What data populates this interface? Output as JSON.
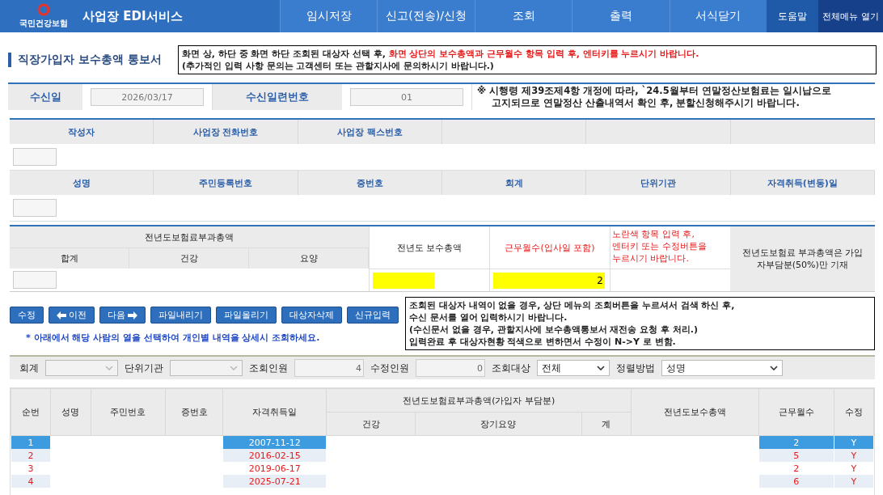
{
  "header": {
    "logo_text": "국민건강보험",
    "title": "사업장 EDI서비스",
    "menu": [
      {
        "label": "임시저장"
      },
      {
        "label": "신고(전송)/신청"
      },
      {
        "label": "조회"
      },
      {
        "label": "출력"
      },
      {
        "label": "서식닫기"
      }
    ],
    "help": "도움말",
    "all_menu": "전체메뉴 열기"
  },
  "page_title": "직장가입자 보수총액 통보서",
  "notice_top": [
    [
      {
        "text": "화면 상, 하단 중 화면 하단 조회된 대상자 선택 후, ",
        "emphasis": false
      },
      {
        "text": "화면 상단의 보수총액과 근무월수 항목 입력 후, 엔터키를 누르시기 바랍니다.",
        "emphasis": true
      }
    ],
    [
      {
        "text": "(추가적인 입력 사항 문의는 고객센터 또는 관할지사에 문의하시기 바랍니다.)",
        "emphasis": false
      }
    ]
  ],
  "receipt": {
    "date_label": "수신일",
    "date": "2026/03/17",
    "serial_label": "수신일련번호",
    "serial": "01",
    "notice": [
      "※ 시행령 제39조제4항 개정에 따라, `24.5월부터 연말정산보험료는 일시납으로",
      "고지되므로 연말정산 산출내역서 확인 후, 분할신청해주시기 바랍니다."
    ]
  },
  "company_columns": [
    "작성자",
    "사업장 전화번호",
    "사업장 팩스번호"
  ],
  "member_columns": [
    "성명",
    "주민등록번호",
    "증번호",
    "회계",
    "단위기관",
    "자격취득(변동)일"
  ],
  "premium": {
    "group": "전년도보험료부과총액",
    "subs": [
      "합계",
      "건강",
      "요양"
    ],
    "pay_total": "전년도 보수총액",
    "months": "근무월수(입사일 포함)",
    "hint": [
      "노란색 항목 입력 후,",
      "엔터키 또는 수정버튼을",
      "누르시기 바랍니다."
    ],
    "note": "전년도보험료 부과총액은 가입자부담분(50%)만 기재",
    "months_value": "2",
    "highlighted": true
  },
  "buttons": [
    {
      "label": "수정",
      "kind": "plain"
    },
    {
      "label": "이전",
      "kind": "prev"
    },
    {
      "label": "다음",
      "kind": "next"
    },
    {
      "label": "파일내리기",
      "kind": "plain"
    },
    {
      "label": "파일올리기",
      "kind": "plain"
    },
    {
      "label": "대상자삭제",
      "kind": "plain"
    },
    {
      "label": "신규입력",
      "kind": "plain"
    }
  ],
  "row_hint": "* 아래에서 해당 사람의 열을 선택하여 개인별 내역을 상세시 조회하세요.",
  "notice_box": [
    "조회된 대상자 내역이 없을 경우, 상단 메뉴의 조회버튼을 누르셔서 검색 하신 후,",
    "수신 문서를 열어 입력하시기 바랍니다.",
    "(수신문서 없을 경우, 관할지사에 보수총액통보서 재전송 요청 후 처리.)",
    "입력완료 후 대상자현황 적색으로 변하면서 수정이 N->Y 로 변함."
  ],
  "filters": [
    {
      "label": "회계",
      "kind": "select",
      "disabled": true
    },
    {
      "label": "단위기관",
      "kind": "select",
      "disabled": true
    },
    {
      "label": "조회인원",
      "kind": "number",
      "value": "4",
      "disabled": true
    },
    {
      "label": "수정인원",
      "kind": "number",
      "value": "0",
      "disabled": true
    },
    {
      "label": "조회대상",
      "kind": "select",
      "value": "전체",
      "disabled": false
    },
    {
      "label": "정렬방법",
      "kind": "select",
      "value": "성명",
      "disabled": false
    }
  ],
  "table": {
    "columns": [
      "순번",
      "성명",
      "주민번호",
      "증번호",
      "자격취득일"
    ],
    "group": "전년도보험료부과총액(가입자 부담분)",
    "group_subs": [
      "건강",
      "장기요양",
      "계"
    ],
    "tail_columns": [
      "전년도보수총액",
      "근무월수",
      "수정"
    ],
    "rows": [
      {
        "no": "1",
        "date": "2007-11-12",
        "months": "2",
        "edited": "Y",
        "selected": true,
        "modified": true
      },
      {
        "no": "2",
        "date": "2016-02-15",
        "months": "5",
        "edited": "Y",
        "selected": false,
        "modified": true
      },
      {
        "no": "3",
        "date": "2019-06-17",
        "months": "2",
        "edited": "Y",
        "selected": false,
        "modified": true
      },
      {
        "no": "4",
        "date": "2025-07-21",
        "months": "6",
        "edited": "Y",
        "selected": false,
        "modified": true
      }
    ]
  }
}
